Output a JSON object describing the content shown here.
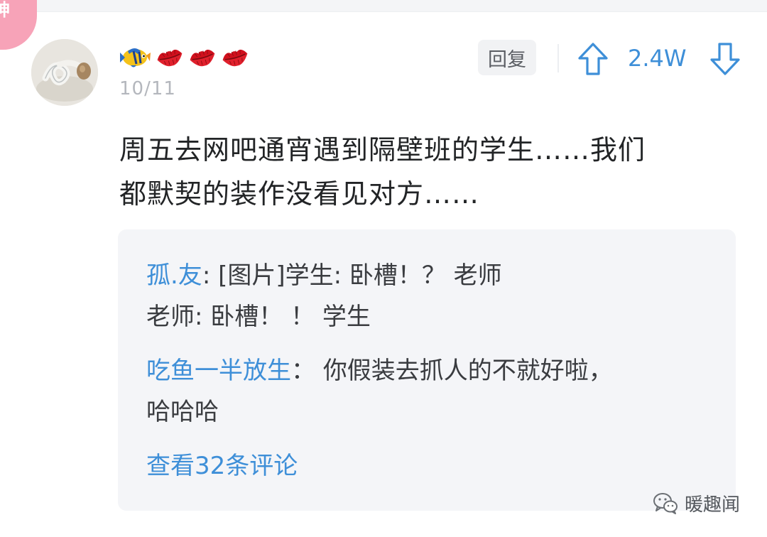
{
  "badge": {
    "label": "神"
  },
  "user": {
    "emoji_icons": [
      "tropical-fish-icon",
      "kiss-mark-icon",
      "kiss-mark-icon",
      "kiss-mark-icon"
    ],
    "date": "10/11"
  },
  "actions": {
    "reply_label": "回复",
    "vote_count": "2.4W",
    "upvote_icon": "arrow-up-icon",
    "downvote_icon": "arrow-down-icon"
  },
  "comment": {
    "line1": "周五去网吧通宵遇到隔壁班的学生……我们",
    "line2": "都默契的装作没看见对方……"
  },
  "replies": [
    {
      "author": "孤.友",
      "separator": ": ",
      "line1_text": "[图片]学生: 卧槽！？ 老师",
      "line2_text": "老师: 卧槽！ ！ 学生"
    },
    {
      "author": "吃鱼一半放生",
      "separator": "： ",
      "line1_text": "你假装去抓人的不就好啦，",
      "line2_text": "哈哈哈"
    }
  ],
  "view_more": "查看32条评论",
  "watermark": {
    "icon": "wechat-icon",
    "text": "暖趣闻"
  },
  "colors": {
    "accent_blue": "#3e8fd8",
    "badge_pink": "#f7a3b8",
    "reply_box_bg": "#f4f5f8"
  }
}
